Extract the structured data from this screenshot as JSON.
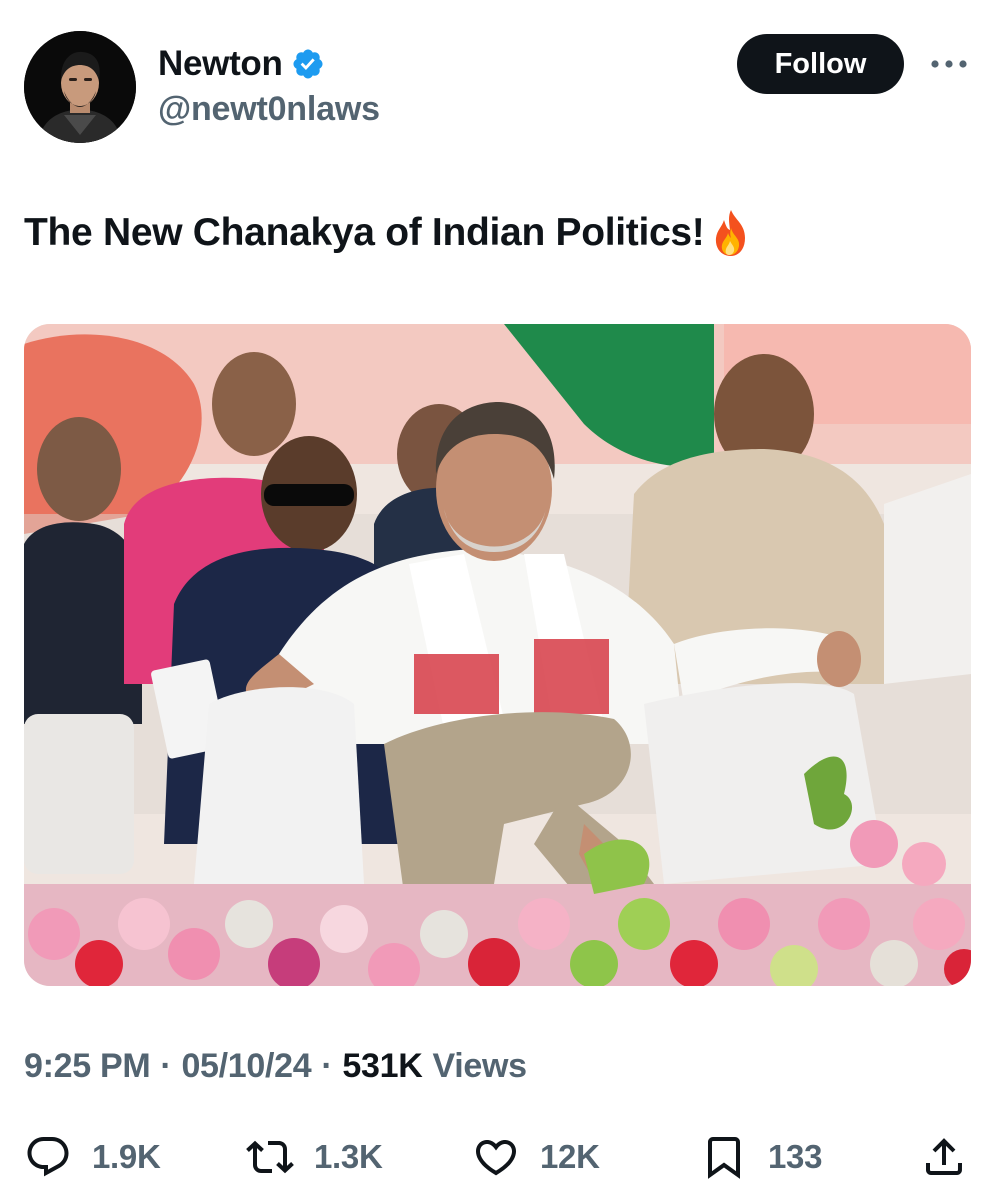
{
  "author": {
    "display_name": "Newton",
    "handle": "@newt0nlaws",
    "verified": true,
    "avatar_icon": "profile-photo"
  },
  "follow_label": "Follow",
  "tweet": {
    "text": "The New Chanakya of Indian Politics!",
    "emoji_icon": "fire-icon"
  },
  "meta": {
    "time": "9:25 PM",
    "date": "05/10/24",
    "views_count": "531K",
    "views_label": "Views",
    "separator": "·"
  },
  "actions": {
    "replies": "1.9K",
    "reposts": "1.3K",
    "likes": "12K",
    "bookmarks": "133"
  },
  "colors": {
    "text_primary": "#0f1419",
    "text_secondary": "#536471",
    "verified_blue": "#1d9bf0",
    "follow_bg": "#0f1419"
  }
}
